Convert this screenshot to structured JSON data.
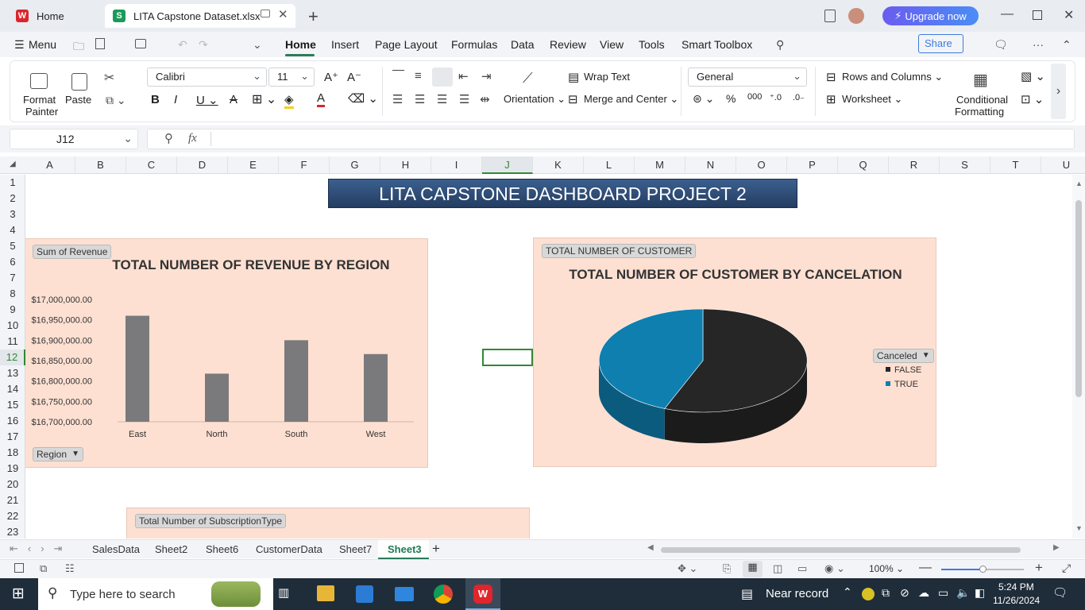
{
  "window_tabs": [
    {
      "label": "Home"
    },
    {
      "label": "LITA Capstone Dataset.xlsx"
    }
  ],
  "upgrade_label": "Upgrade now",
  "menu": {
    "menu_label": "Menu",
    "items": [
      "Home",
      "Insert",
      "Page Layout",
      "Formulas",
      "Data",
      "Review",
      "View",
      "Tools",
      "Smart Toolbox"
    ],
    "share_label": "Share"
  },
  "ribbon": {
    "format_painter": "Format\nPainter",
    "format_painter_1": "Format",
    "format_painter_2": "Painter",
    "paste": "Paste",
    "font_name": "Calibri",
    "font_size": "11",
    "wrap_text": "Wrap Text",
    "merge_center": "Merge and Center",
    "orientation": "Orientation",
    "number_format": "General",
    "rows_columns": "Rows and Columns",
    "worksheet": "Worksheet",
    "cond_format_1": "Conditional",
    "cond_format_2": "Formatting"
  },
  "formula_bar": {
    "cell_ref": "J12",
    "fx": "fx",
    "value": ""
  },
  "columns": [
    "A",
    "B",
    "C",
    "D",
    "E",
    "F",
    "G",
    "H",
    "I",
    "J",
    "K",
    "L",
    "M",
    "N",
    "O",
    "P",
    "Q",
    "R",
    "S",
    "T",
    "U"
  ],
  "rows": [
    "1",
    "2",
    "3",
    "4",
    "5",
    "6",
    "7",
    "8",
    "9",
    "10",
    "11",
    "12",
    "13",
    "14",
    "15",
    "16",
    "17",
    "18",
    "19",
    "20",
    "21",
    "22",
    "23"
  ],
  "dashboard_title": "LITA CAPSTONE DASHBOARD PROJECT 2",
  "revenue_chart": {
    "field_button": "Sum of Revenue",
    "axis_field_button": "Region"
  },
  "customer_chart": {
    "field_button": "TOTAL NUMBER OF CUSTOMER",
    "legend_button": "Canceled"
  },
  "subscription_panel": {
    "field_button": "Total Number of SubscriptionType"
  },
  "chart_data": [
    {
      "type": "bar",
      "title": "TOTAL NUMBER OF REVENUE BY REGION",
      "categories": [
        "East",
        "North",
        "South",
        "West"
      ],
      "values": [
        16960000,
        16818000,
        16900000,
        16866000
      ],
      "y_ticks": [
        "$17,000,000.00",
        "$16,950,000.00",
        "$16,900,000.00",
        "$16,850,000.00",
        "$16,800,000.00",
        "$16,750,000.00",
        "$16,700,000.00"
      ],
      "ylim": [
        16700000,
        17000000
      ],
      "color": "#7a7a7c"
    },
    {
      "type": "pie",
      "title": "TOTAL NUMBER OF CUSTOMER  BY CANCELATION",
      "categories": [
        "FALSE",
        "TRUE"
      ],
      "values": [
        56,
        44
      ],
      "colors": [
        "#262626",
        "#0f7fb0"
      ],
      "legend_title": "Canceled",
      "legend_position": "right"
    }
  ],
  "sheet_tabs": [
    "SalesData",
    "Sheet2",
    "Sheet6",
    "CustomerData",
    "Sheet7",
    "Sheet3"
  ],
  "active_sheet": "Sheet3",
  "status": {
    "zoom": "100%"
  },
  "taskbar": {
    "search_placeholder": "Type here to search",
    "weather": "Near record",
    "time": "5:24 PM",
    "date": "11/26/2024"
  }
}
